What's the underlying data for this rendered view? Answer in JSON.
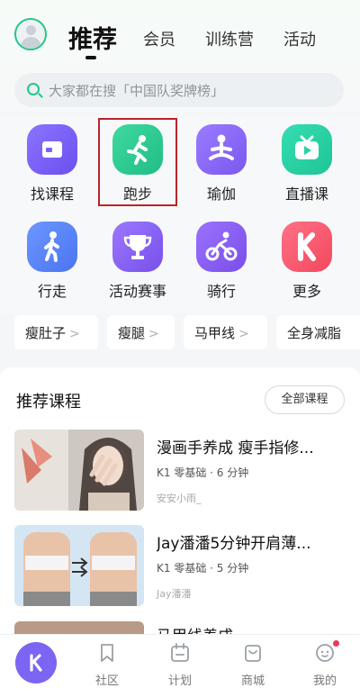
{
  "tabs": [
    "推荐",
    "会员",
    "训练营",
    "活动"
  ],
  "search": {
    "placeholder": "大家都在搜「中国队奖牌榜」"
  },
  "grid": [
    {
      "label": "找课程",
      "icon": "course-icon",
      "color": "#7b61ff"
    },
    {
      "label": "跑步",
      "icon": "running-icon",
      "color": "#28c98e"
    },
    {
      "label": "瑜伽",
      "icon": "yoga-icon",
      "color": "#8a6af5"
    },
    {
      "label": "直播课",
      "icon": "live-tv-icon",
      "color": "#2ad1a3"
    },
    {
      "label": "行走",
      "icon": "walking-icon",
      "color": "#5a86f8"
    },
    {
      "label": "活动赛事",
      "icon": "trophy-icon",
      "color": "#8b64f2"
    },
    {
      "label": "骑行",
      "icon": "cycling-icon",
      "color": "#8a5ef0"
    },
    {
      "label": "更多",
      "icon": "keep-logo-icon",
      "color": "#f65b6f"
    }
  ],
  "chips": [
    "瘦肚子",
    "瘦腿",
    "马甲线",
    "全身减脂"
  ],
  "recommend": {
    "title": "推荐课程",
    "all_label": "全部课程",
    "courses": [
      {
        "title": "漫画手养成 瘦手指修...",
        "meta": "K1 零基础 · 6 分钟",
        "author": "安安小雨_"
      },
      {
        "title": "Jay潘潘5分钟开肩薄...",
        "meta": "K1 零基础 · 5 分钟",
        "author": "Jay潘潘"
      },
      {
        "title": "马甲线养成"
      }
    ]
  },
  "nav": {
    "items": [
      {
        "label": "社区",
        "icon": "community-icon"
      },
      {
        "label": "计划",
        "icon": "calendar-icon"
      },
      {
        "label": "商城",
        "icon": "mall-icon"
      },
      {
        "label": "我的",
        "icon": "profile-icon"
      }
    ],
    "badge_color": "#f0365a"
  },
  "accent": "#24c789"
}
